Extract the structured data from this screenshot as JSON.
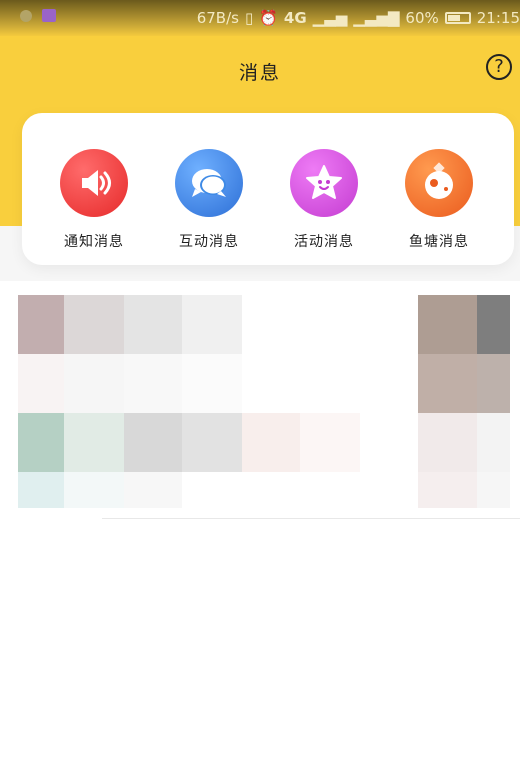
{
  "status_bar": {
    "speed": "67B/s",
    "network": "4G",
    "battery": "60%",
    "time": "21:15"
  },
  "header": {
    "title": "消息",
    "help_symbol": "?"
  },
  "categories": [
    {
      "label": "通知消息",
      "icon": "speaker-icon",
      "color": "#f03a3a"
    },
    {
      "label": "互动消息",
      "icon": "chat-bubbles-icon",
      "color": "#3e8ae6"
    },
    {
      "label": "活动消息",
      "icon": "star-icon",
      "color": "#d54ce0"
    },
    {
      "label": "鱼塘消息",
      "icon": "fish-pond-icon",
      "color": "#f2692a"
    }
  ],
  "colors": {
    "header_bg": "#f9cf3d",
    "page_bg": "#ffffff"
  }
}
